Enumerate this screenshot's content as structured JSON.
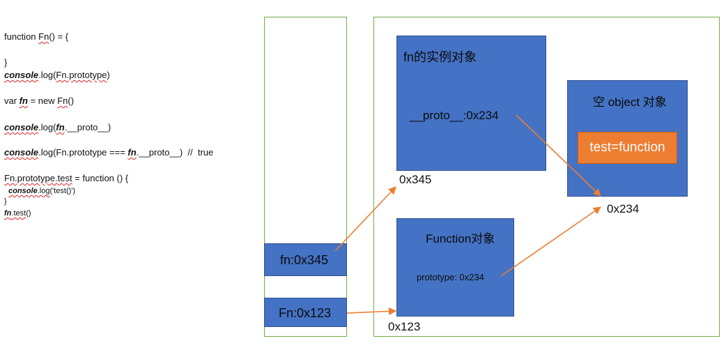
{
  "code": {
    "line1": [
      "function ",
      "Fn",
      "() = {"
    ],
    "line2": "}",
    "line3": [
      "console",
      ".log(",
      "Fn.prototype",
      ")"
    ],
    "line4": [
      "var ",
      "fn",
      " = new ",
      "Fn",
      "()"
    ],
    "line5": [
      "console",
      ".log(",
      "fn",
      ".__proto__)"
    ],
    "line6": [
      "console",
      ".log(Fn.prototype === ",
      "fn",
      ".__proto__)  //  true"
    ],
    "line7": [
      "Fn.prototype.test",
      " = function () {"
    ],
    "line8": [
      "console",
      ".log",
      "('test()')"
    ],
    "line9": "}",
    "line10": [
      "fn",
      ".test",
      "()"
    ]
  },
  "stack": {
    "fn_cell": "fn:0x345",
    "Fn_cell": "Fn:0x123"
  },
  "heap": {
    "instance_box": {
      "title": "fn的实例对象",
      "proto": "__proto__:0x234",
      "address": "0x345"
    },
    "empty_object_box": {
      "title": "空 object 对象",
      "member": "test=function",
      "address": "0x234"
    },
    "function_box": {
      "title": "Function对象",
      "prototype": "prototype: 0x234",
      "address": "0x123"
    }
  },
  "colors": {
    "box_fill": "#4472c4",
    "member_fill": "#ed7d31",
    "arrow": "#ed7d31",
    "frame": "#70ad47"
  }
}
